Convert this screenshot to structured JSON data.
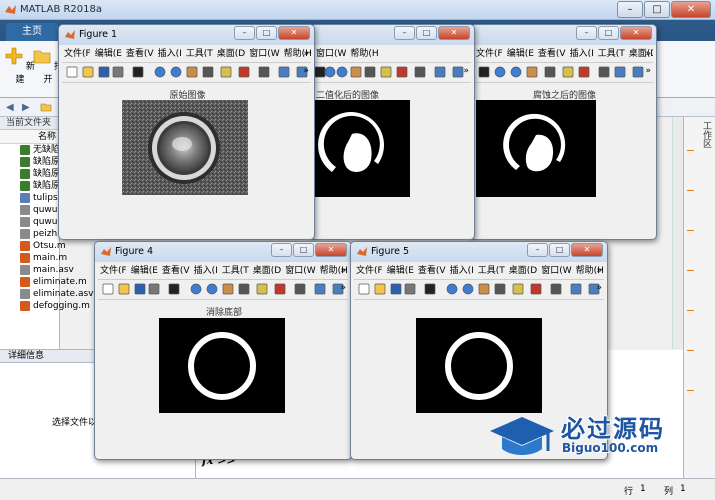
{
  "matlab": {
    "title": "MATLAB R2018a",
    "home_tab": "主页",
    "ribbon_buttons": [
      "新建",
      "打开"
    ],
    "current_folder_label": "当前文件夹",
    "name_header": "名称",
    "files": [
      "无缺陷",
      "缺陷原",
      "缺陷原",
      "缺陷原",
      "tulips",
      "quwu",
      "quwu",
      "peizh",
      "Otsu.m",
      "main.m",
      "main.asv",
      "eliminate.m",
      "eliminate.asv",
      "defogging.m"
    ],
    "details_label": "详细信息",
    "details_hint": "选择文件以",
    "workspace_label": "工作区",
    "prompt": "fx >>",
    "status_row_label": "行",
    "status_row_value": "1",
    "status_col_label": "列",
    "status_col_value": "1"
  },
  "menus": {
    "fig1": [
      "文件(F",
      "编辑(E",
      "查看(V",
      "插入(I",
      "工具(T",
      "桌面(D",
      "窗口(W",
      "帮助(H"
    ],
    "fig4": [
      "文件(F",
      "编辑(E",
      "查看(V",
      "插入(I",
      "工具(T",
      "桌面(D",
      "窗口(W",
      "帮助(H"
    ],
    "fig5": [
      "文件(F",
      "编辑(E",
      "查看(V",
      "插入(I",
      "工具(T",
      "桌面(D",
      "窗口(W",
      "帮助(H"
    ],
    "fig3": [
      "文件(F",
      "编辑(E",
      "查看(V",
      "插入(I",
      "工具(T",
      "桌面(D",
      "窗口(W",
      "帮助(H"
    ]
  },
  "figures": {
    "fig1": {
      "title": "Figure 1",
      "image_title": "原始图像"
    },
    "fig2": {
      "image_title": "二值化后的图像"
    },
    "fig3": {
      "image_title": "腐蚀之后的图像"
    },
    "fig4": {
      "title": "Figure 4",
      "image_title": "消除底部"
    },
    "fig5": {
      "title": "Figure 5",
      "image_title": ""
    }
  },
  "watermark": {
    "cn": "必过源码",
    "en": "Biguo100.com"
  },
  "colors": {
    "ribbon": "#1e4774",
    "accent": "#e87d1e",
    "watermark": "#1f55a3"
  }
}
